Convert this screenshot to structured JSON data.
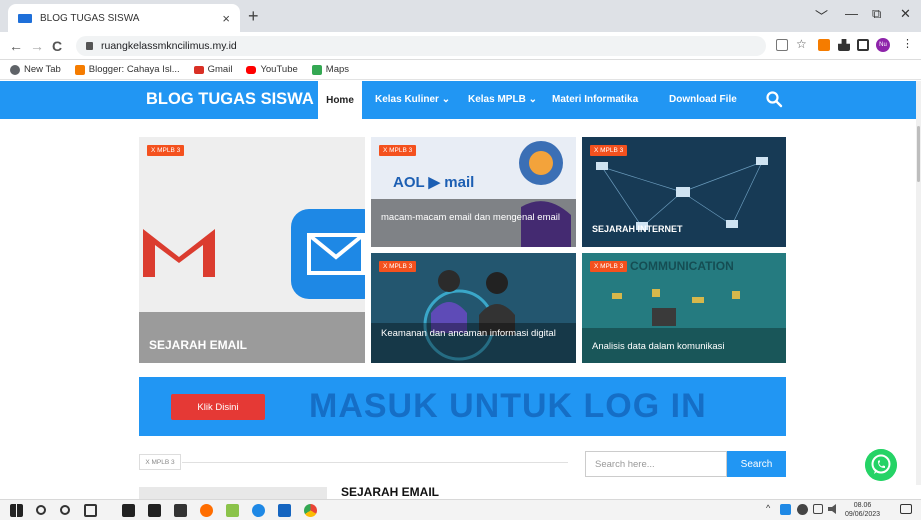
{
  "browser": {
    "tab_title": "BLOG TUGAS SISWA",
    "tab_close": "×",
    "new_tab": "+",
    "url": "ruangkelassmkncilimus.my.id",
    "window_controls": [
      "﹀",
      "—",
      "⧉",
      "✕"
    ],
    "nav": {
      "back": "←",
      "forward": "→",
      "reload": "C"
    },
    "bookmarks": [
      {
        "label": "New Tab",
        "color": "#5f6368"
      },
      {
        "label": "Blogger: Cahaya Isl...",
        "color": "#f57c00"
      },
      {
        "label": "Gmail",
        "color": "#d93025"
      },
      {
        "label": "YouTube",
        "color": "#ff0000"
      },
      {
        "label": "Maps",
        "color": "#34a853"
      }
    ],
    "profile_initials": "Nu"
  },
  "site": {
    "brand": "BLOG TUGAS SISWA",
    "nav": {
      "home": "Home",
      "kuliner": "Kelas Kuliner ⌄",
      "mplb": "Kelas MPLB ⌄",
      "informatika": "Materi Informatika",
      "download": "Download File"
    },
    "accent": "#2196f3"
  },
  "featured": [
    {
      "badge": "X MPLB 3",
      "title": "SEJARAH EMAIL"
    },
    {
      "badge": "X MPLB 3",
      "title": "macam-macam email dan mengenal email"
    },
    {
      "badge": "X MPLB 3",
      "title": "SEJARAH INTERNET"
    },
    {
      "badge": "X MPLB 3",
      "title": "Keamanan dan ancaman informasi digital"
    },
    {
      "badge": "X MPLB 3",
      "title": "Analisis data dalam komunikasi"
    }
  ],
  "card_art": {
    "aol_text": "AOL ▶ mail",
    "communication_text": "COMMUNICATION"
  },
  "banner": {
    "button": "Klik Disini",
    "text": "MASUK UNTUK LOG IN"
  },
  "content": {
    "tag": "X MPLB 3",
    "search_placeholder": "Search here...",
    "search_button": "Search",
    "post_title": "SEJARAH EMAIL"
  },
  "taskbar": {
    "tray": "^",
    "time": "08.06",
    "date": "09/06/2023"
  }
}
